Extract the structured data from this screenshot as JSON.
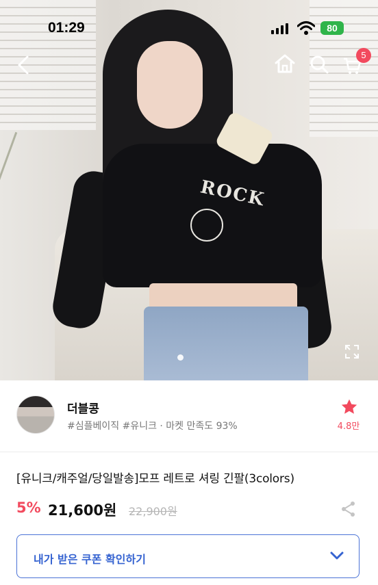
{
  "status_bar": {
    "time": "01:29",
    "battery": "80"
  },
  "nav": {
    "cart_count": "5"
  },
  "shop": {
    "name": "더블콩",
    "tags": "#심플베이직 #유니크 · 마켓 만족도 93%",
    "likes": "4.8만"
  },
  "product": {
    "title": "[유니크/캐주얼/당일발송]모프 레트로 셔링 긴팔(3colors)",
    "discount": "5%",
    "price": "21,600원",
    "original_price": "22,900원"
  },
  "coupon": {
    "label": "내가 받은 쿠폰 확인하기"
  },
  "colors": {
    "accent_red": "#f24a5e",
    "accent_blue": "#3563d1",
    "battery_green": "#2fb44a"
  }
}
